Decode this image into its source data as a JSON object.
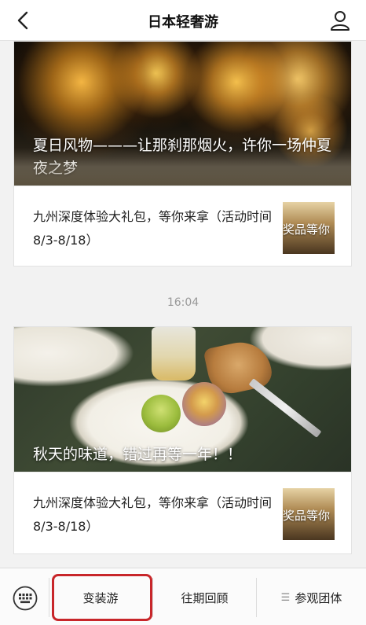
{
  "header": {
    "title": "日本轻奢游"
  },
  "articles": [
    {
      "cover_title": "夏日风物———让那刹那烟火，许你一场仲夏夜之梦",
      "sub_title": "九州深度体验大礼包，等你来拿（活动时间8/3-8/18）",
      "thumb_text": "奖品等你"
    },
    {
      "cover_title": "秋天的味道，错过再等一年！！",
      "sub_title": "九州深度体验大礼包，等你来拿（活动时间8/3-8/18）",
      "thumb_text": "奖品等你"
    }
  ],
  "timestamp": "16:04",
  "bottom_menu": {
    "items": [
      {
        "label": "变装游"
      },
      {
        "label": "往期回顾"
      },
      {
        "label": "参观团体",
        "icon": "menu-list-icon"
      }
    ]
  },
  "colors": {
    "highlight_border": "#c8262a",
    "timestamp": "#999999"
  }
}
